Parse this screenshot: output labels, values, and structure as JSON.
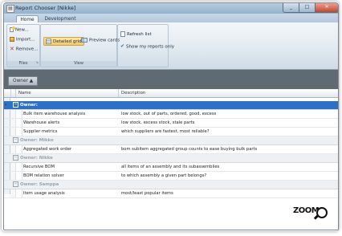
{
  "window": {
    "title": "Report Chooser [Nikke]",
    "app_icon": "form-icon",
    "buttons": [
      "_",
      "□",
      "✕"
    ]
  },
  "ribbon": {
    "tabs": [
      {
        "label": "Home",
        "active": true
      },
      {
        "label": "Development",
        "active": false
      }
    ],
    "groups": {
      "files": {
        "label": "Files",
        "new": "New...",
        "import": "Import...",
        "remove": "Remove..."
      },
      "view": {
        "label": "View",
        "detailed_grid": "Detailed grid",
        "preview_cards": "Preview cards",
        "selected": "Detailed grid"
      },
      "reports": {
        "refresh": "Refresh list",
        "show_mine": "Show my reports only"
      }
    }
  },
  "groupby": {
    "chip": "Owner ▲"
  },
  "grid": {
    "columns": [
      "Name",
      "Description"
    ],
    "groups": [
      {
        "title": "Owner:",
        "selected": true,
        "rows": [
          {
            "name": "Bulk item warehouse analysis",
            "description": "low stock, out of parts, ordered, good, excess"
          },
          {
            "name": "Warehouse alerts",
            "description": "low stock, excess stock, stale parts"
          },
          {
            "name": "Supplier metrics",
            "description": "which suppliers are fastest, most reliable?"
          }
        ]
      },
      {
        "title": "Owner: Mikko",
        "selected": false,
        "rows": [
          {
            "name": "Aggregated work order",
            "description": "bom subitem aggregated group counts to ease buying bulk parts"
          }
        ]
      },
      {
        "title": "Owner: Nikke",
        "selected": false,
        "rows": [
          {
            "name": "Recursive BOM",
            "description": "all items of an assembly and its subassemblies"
          },
          {
            "name": "BOM relation solver",
            "description": "to which assembly a given part belongs?"
          }
        ]
      },
      {
        "title": "Owner: Samppa",
        "selected": false,
        "rows": [
          {
            "name": "Item usage analysis",
            "description": "most/least popular items"
          }
        ]
      }
    ]
  },
  "watermark": {
    "text": "ZOOM"
  },
  "colors": {
    "selection": "#2d70c8",
    "groupbar": "#606a73",
    "ribbon_highlight": "#f6c764"
  }
}
